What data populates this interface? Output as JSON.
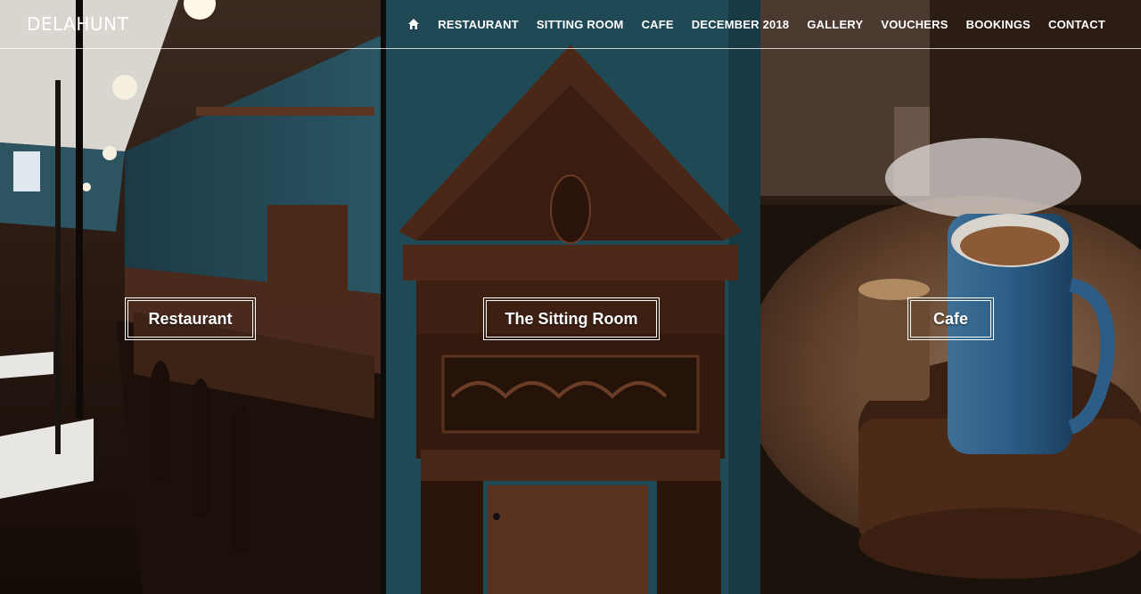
{
  "brand": {
    "logo": "DELAHUNT"
  },
  "nav": {
    "home_icon": "home-icon",
    "items": [
      {
        "label": "RESTAURANT"
      },
      {
        "label": "SITTING ROOM"
      },
      {
        "label": "CAFE"
      },
      {
        "label": "DECEMBER 2018"
      },
      {
        "label": "GALLERY"
      },
      {
        "label": "VOUCHERS"
      },
      {
        "label": "BOOKINGS"
      },
      {
        "label": "CONTACT"
      }
    ]
  },
  "panels": [
    {
      "label": "Restaurant"
    },
    {
      "label": "The Sitting Room"
    },
    {
      "label": "Cafe"
    }
  ],
  "colors": {
    "text": "#ffffff",
    "teal_wall": "#1f4a55",
    "wood": "#3b1f14",
    "coffee_blue": "#2d6a93"
  }
}
